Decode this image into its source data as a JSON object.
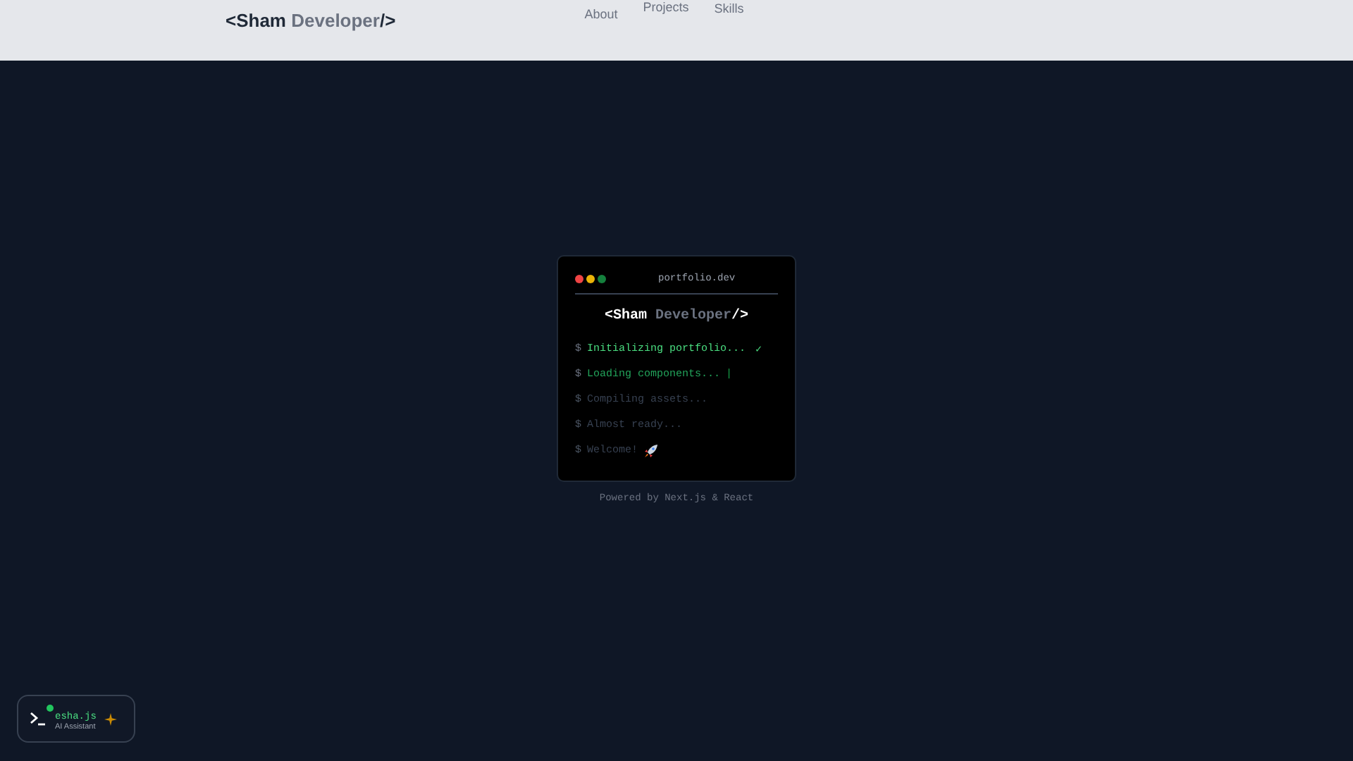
{
  "header": {
    "logo": {
      "name": "Sham",
      "role": "Developer",
      "close": "/>",
      "open": "<"
    },
    "nav": [
      {
        "label": "About"
      },
      {
        "label": "Projects"
      },
      {
        "label": "Skills"
      }
    ]
  },
  "terminal": {
    "title": "portfolio.dev",
    "brand": {
      "open": "<",
      "name": "Sham",
      "role": "Developer",
      "close": "/>"
    },
    "lines": [
      {
        "prompt": "$",
        "text": "Initializing portfolio...",
        "kind": "done",
        "mark": "✓"
      },
      {
        "prompt": "$",
        "text": "Loading components...",
        "kind": "active",
        "mark": "|"
      },
      {
        "prompt": "$",
        "text": "Compiling assets...",
        "kind": "pending"
      },
      {
        "prompt": "$",
        "text": "Almost ready...",
        "kind": "pending"
      },
      {
        "prompt": "$",
        "text": "Welcome!",
        "kind": "final"
      }
    ]
  },
  "footer_note": "Powered by Next.js & React",
  "assistant": {
    "name": "esha.js",
    "subtitle": "AI Assistant",
    "online": true
  }
}
